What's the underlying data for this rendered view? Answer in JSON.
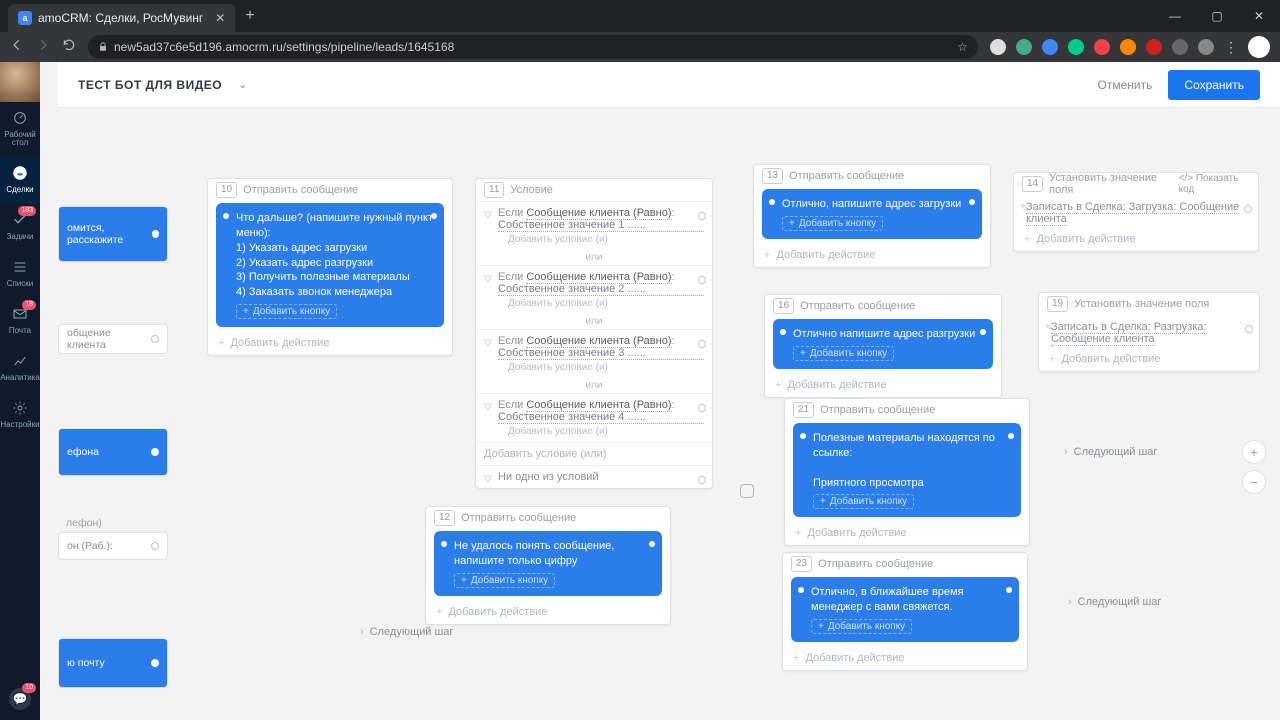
{
  "browser": {
    "tab_title": "amoCRM: Сделки, РосМувинг",
    "tab_initial": "a",
    "url": "new5ad37c6e5d196.amocrm.ru/settings/pipeline/leads/1645168"
  },
  "sidebar": {
    "items": [
      {
        "label": "Рабочий\nстол",
        "active": false
      },
      {
        "label": "Сделки",
        "active": true
      },
      {
        "label": "Задачи",
        "active": false,
        "badge": "183"
      },
      {
        "label": "Списки",
        "active": false
      },
      {
        "label": "Почта",
        "active": false,
        "badge": "18"
      },
      {
        "label": "Аналитика",
        "active": false
      },
      {
        "label": "Настройки",
        "active": false
      }
    ]
  },
  "topbar": {
    "pipeline_title": "ТЕСТ БОТ ДЛЯ ВИДЕО",
    "cancel": "Отменить",
    "save": "Сохранить"
  },
  "box10": {
    "num": "10",
    "title": "Отправить сообщение",
    "msg": "Что дальше? (напишите нужный пункт меню):\n1) Указать адрес загрузки\n2) Указать адрес разгрузки\n3) Получить полезные материалы\n4) Заказать звонок менеджера",
    "addbtn": "Добавить кнопку",
    "addaction": "Добавить действие"
  },
  "box11": {
    "num": "11",
    "title": "Условие",
    "rows": [
      {
        "pre": "Если",
        "field": "Сообщение клиента (Равно)",
        "val": "Собственное значение 1 ......",
        "add": "Добавить условие (и)"
      },
      {
        "pre": "Если",
        "field": "Сообщение клиента (Равно)",
        "val": "Собственное значение 2 ......",
        "add": "Добавить условие (и)"
      },
      {
        "pre": "Если",
        "field": "Сообщение клиента (Равно)",
        "val": "Собственное значение 3 ......",
        "add": "Добавить условие (и)"
      },
      {
        "pre": "Если",
        "field": "Сообщение клиента (Равно)",
        "val": "Собственное значение 4 ......",
        "add": "Добавить условие (и)"
      }
    ],
    "or": "или",
    "addcond_or": "Добавить условие (или)",
    "none": "Ни одно из условий"
  },
  "box12": {
    "num": "12",
    "title": "Отправить сообщение",
    "msg": "Не удалось понять сообщение, напишите только цифру",
    "addbtn": "Добавить кнопку",
    "addaction": "Добавить действие"
  },
  "box13": {
    "num": "13",
    "title": "Отправить сообщение",
    "msg": "Отлично, напишите адрес загрузки",
    "addbtn": "Добавить кнопку",
    "addaction": "Добавить действие"
  },
  "box14": {
    "num": "14",
    "title": "Установить значение поля",
    "showcode": "Показать код",
    "line": "Записать в Сделка: Загрузка: Сообщение клиента",
    "addaction": "Добавить действие"
  },
  "box16": {
    "num": "16",
    "title": "Отправить сообщение",
    "msg": "Отлично напишите адрес разгрузки",
    "addbtn": "Добавить кнопку",
    "addaction": "Добавить действие"
  },
  "box19": {
    "num": "19",
    "title": "Установить значение поля",
    "line": "Записать в Сделка: Разгрузка: Сообщение клиента",
    "addaction": "Добавить действие"
  },
  "box21": {
    "num": "21",
    "title": "Отправить сообщение",
    "msg": "Полезные материалы находятся по ссылке:\n\nПриятного просмотра",
    "addbtn": "Добавить кнопку",
    "addaction": "Добавить действие"
  },
  "box23": {
    "num": "23",
    "title": "Отправить сообщение",
    "msg": "Отлично, в ближайшее время менеджер с вами свяжется.",
    "addbtn": "Добавить кнопку",
    "addaction": "Добавить действие"
  },
  "chips": {
    "c1": "омится, расскажите",
    "c2": "общение клиента",
    "c3": "ефона",
    "c4": "лефон)",
    "c5": "он (Раб.):",
    "c6": "ю почту"
  },
  "nextstep": "Следующий шаг",
  "codeicon": "</>"
}
